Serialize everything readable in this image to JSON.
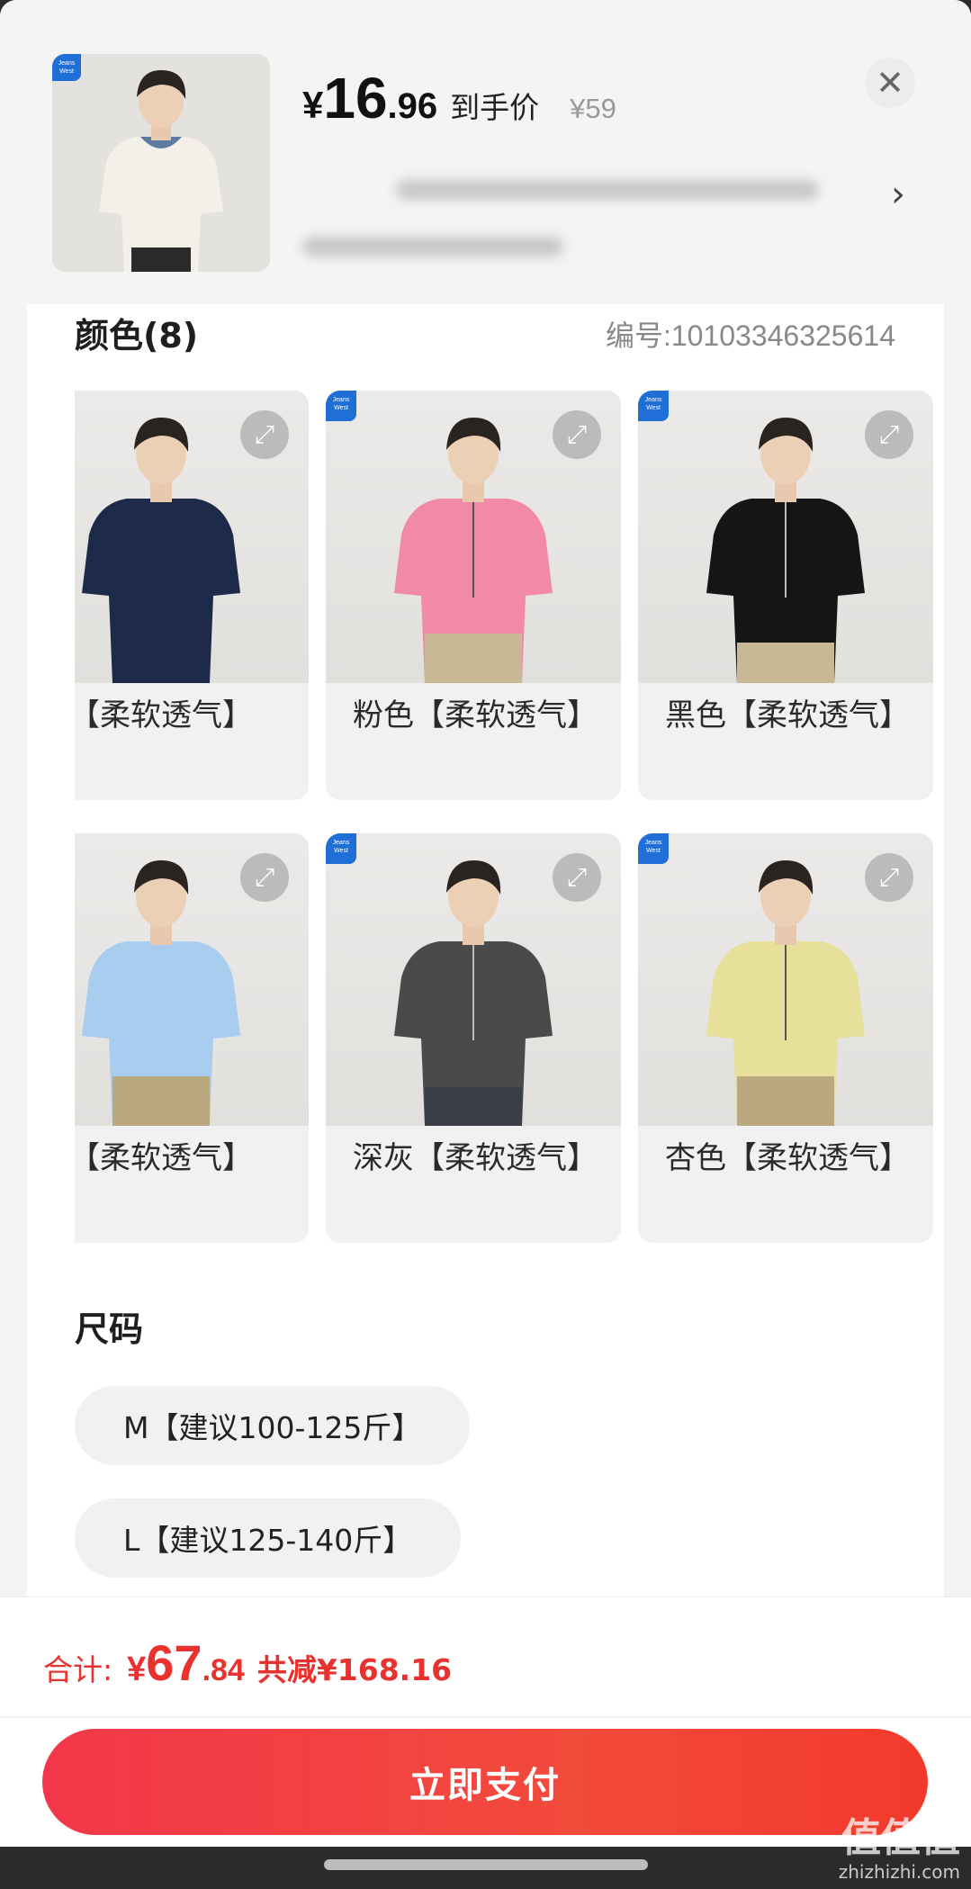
{
  "header": {
    "brand_badge_text": "Jeans West 真维斯",
    "price_currency": "¥",
    "price_int": "16",
    "price_dec": ".96",
    "final_label": "到手价",
    "original_price": "¥59"
  },
  "colors": {
    "title": "颜色(8)",
    "code": "编号:10103346325614",
    "options": [
      {
        "label": "【柔软透气】",
        "shirt": "#1e2a4a"
      },
      {
        "label": "粉色【柔软透气】",
        "shirt": "#f08aa8"
      },
      {
        "label": "黑色【柔软透气】",
        "shirt": "#151515"
      },
      {
        "label": "【柔软透气】",
        "shirt": "#a9cdee"
      },
      {
        "label": "深灰【柔软透气】",
        "shirt": "#4a4a4a"
      },
      {
        "label": "杏色【柔软透气】",
        "shirt": "#e6e09a"
      }
    ]
  },
  "sizes": {
    "title": "尺码",
    "options": [
      "M【建议100-125斤】",
      "L【建议125-140斤】"
    ]
  },
  "footer": {
    "total_label": "合计:",
    "total_currency": "¥",
    "total_int": "67",
    "total_dec": ".84",
    "saved": "共减¥168.16",
    "pay_button": "立即支付"
  },
  "watermark": {
    "main": "值值值",
    "sub": "zhizhizhi.com"
  },
  "theme": {
    "accent": "#f2374a",
    "price_red": "#e8322f"
  }
}
